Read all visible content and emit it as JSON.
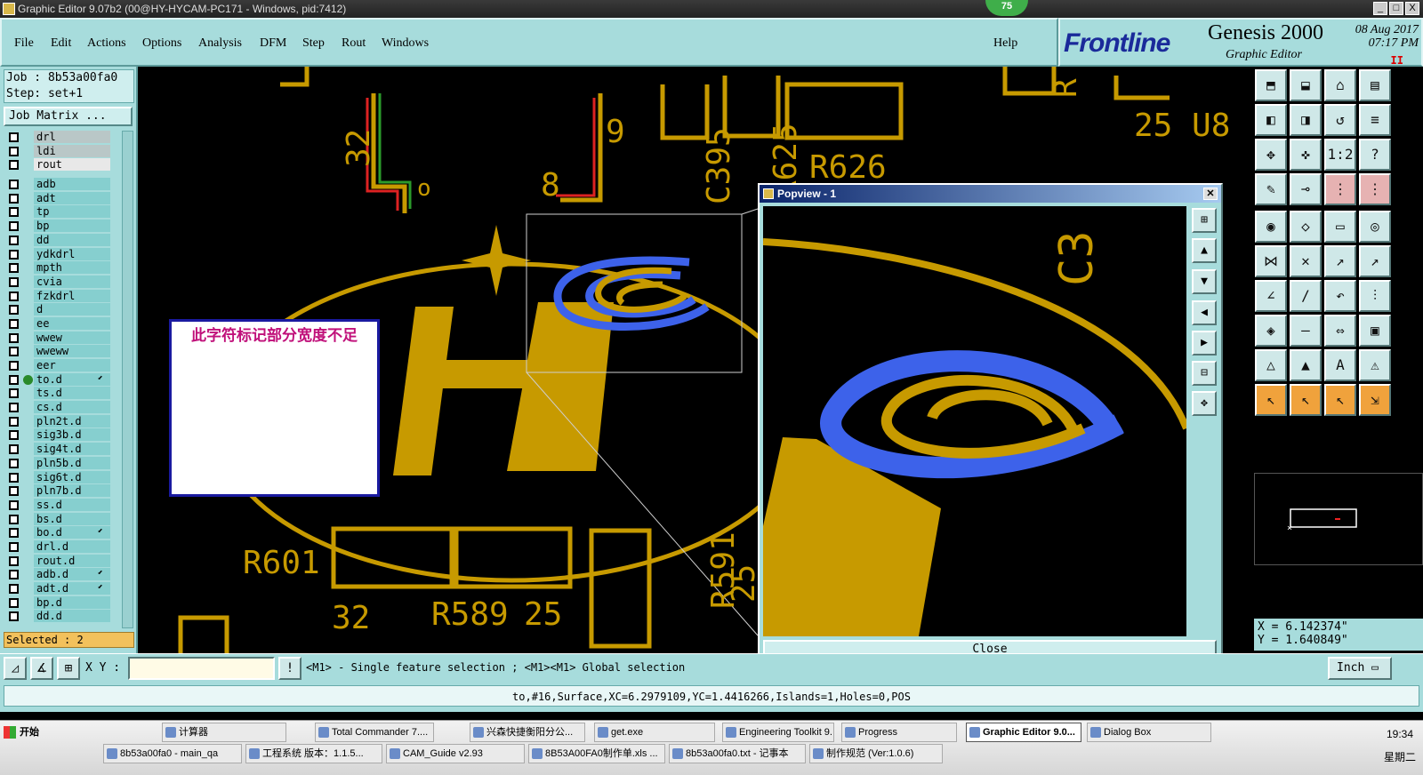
{
  "window": {
    "title": "Graphic Editor 9.07b2 (00@HY-HYCAM-PC171 - Windows, pid:7412)",
    "badge": "75",
    "controls": [
      "_",
      "□",
      "X"
    ]
  },
  "menu": {
    "items": [
      "File",
      "Edit",
      "Actions",
      "Options",
      "Analysis",
      "DFM",
      "Step",
      "Rout",
      "Windows"
    ],
    "help": "Help"
  },
  "brand": {
    "logo": "Frontline",
    "product": "Genesis 2000",
    "subtitle": "Graphic Editor",
    "date": "08 Aug 2017",
    "time": "07:17 PM",
    "rec": "II"
  },
  "job": {
    "job_line": "Job : 8b53a00fa0",
    "step_line": "Step: set+1",
    "matrix_button": "Job Matrix ...",
    "selected": "Selected : 2"
  },
  "layers": [
    {
      "name": "drl",
      "style": "gray"
    },
    {
      "name": "ldi",
      "style": "gray"
    },
    {
      "name": "rout",
      "style": "white"
    },
    {
      "name": "adb"
    },
    {
      "name": "adt"
    },
    {
      "name": "tp"
    },
    {
      "name": "bp"
    },
    {
      "name": "dd"
    },
    {
      "name": "ydkdrl"
    },
    {
      "name": "mpth"
    },
    {
      "name": "cvia"
    },
    {
      "name": "fzkdrl"
    },
    {
      "name": "d"
    },
    {
      "name": "ee"
    },
    {
      "name": "wwew"
    },
    {
      "name": "wweww"
    },
    {
      "name": "eer"
    },
    {
      "name": "to.d",
      "active": true,
      "arrow": true
    },
    {
      "name": "ts.d"
    },
    {
      "name": "cs.d"
    },
    {
      "name": "pln2t.d"
    },
    {
      "name": "sig3b.d"
    },
    {
      "name": "sig4t.d"
    },
    {
      "name": "pln5b.d"
    },
    {
      "name": "sig6t.d"
    },
    {
      "name": "pln7b.d"
    },
    {
      "name": "ss.d"
    },
    {
      "name": "bs.d"
    },
    {
      "name": "bo.d",
      "arrow": true
    },
    {
      "name": "drl.d"
    },
    {
      "name": "rout.d"
    },
    {
      "name": "adb.d",
      "arrow": true
    },
    {
      "name": "adt.d",
      "arrow": true
    },
    {
      "name": "bp.d"
    },
    {
      "name": "dd.d"
    }
  ],
  "canvas_labels": {
    "n32": "32",
    "n9": "9",
    "n8": "8",
    "c395": "C395",
    "r625": "R625",
    "r626": "R626",
    "u8": "25 U8",
    "r601": "R601",
    "b32": "32",
    "r589": "R589",
    "b25": "25",
    "r591": "R591",
    "b25b": "25",
    "o": "o",
    "rr": "R"
  },
  "note": {
    "text": "此字符标记部分宽度不足"
  },
  "popview": {
    "title": "Popview - 1",
    "close": "Close",
    "label_c3": "C3"
  },
  "coords": {
    "x": "X = 6.142374\"",
    "y": "Y = 1.640849\""
  },
  "command": {
    "xy_label": "X Y :",
    "input_value": "",
    "hint": "<M1> - Single feature selection ; <M1><M1> Global selection",
    "units": "Inch"
  },
  "status": {
    "info": "to,#16,Surface,XC=6.2979109,YC=1.4416266,Islands=1,Holes=0,POS"
  },
  "taskbar": {
    "start": "开始",
    "row1": [
      "计算器",
      "Total Commander 7....",
      "兴森快捷衡阳分公...",
      "get.exe",
      "Engineering Toolkit 9...",
      "Progress",
      "Graphic Editor 9.0...",
      "Dialog Box"
    ],
    "row2": [
      "8b53a00fa0 - main_qa",
      "工程系统  版本：1.1.5...",
      "CAM_Guide v2.93",
      "8B53A00FA0制作单.xls ...",
      "8b53a00fa0.txt - 记事本",
      "制作规范 (Ver:1.0.6)"
    ],
    "time": "19:34",
    "day": "星期二"
  },
  "colors": {
    "panel": "#a7dcdc",
    "copper": "#c79a00",
    "highlight": "#3d62ea",
    "note_text": "#c0107a"
  }
}
